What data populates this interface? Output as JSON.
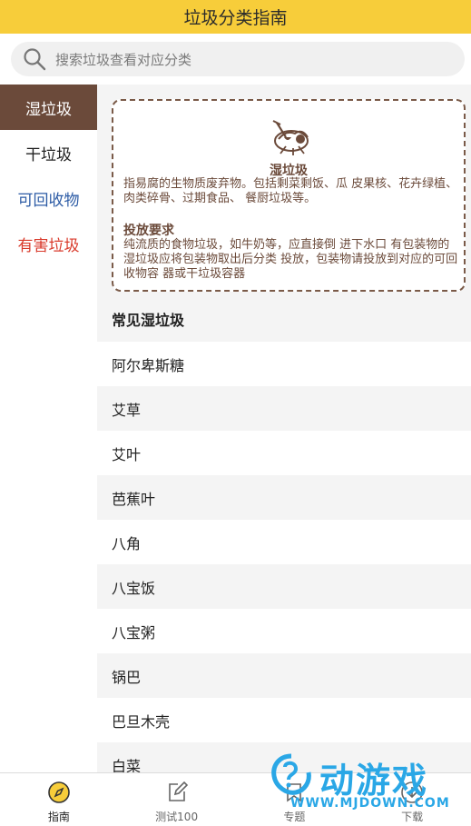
{
  "header": {
    "title": "垃圾分类指南"
  },
  "search": {
    "placeholder": "搜索垃圾查看对应分类",
    "icon": "search-icon"
  },
  "sidebar": {
    "items": [
      {
        "label": "湿垃圾",
        "active": true
      },
      {
        "label": "干垃圾"
      },
      {
        "label": "可回收物"
      },
      {
        "label": "有害垃圾"
      }
    ]
  },
  "card": {
    "title": "湿垃圾",
    "description": "指易腐的生物质废弃物。包括剩菜剩饭、瓜 皮果核、花卉绿植、肉类碎骨、过期食品、 餐厨垃圾等。",
    "requirement_title": "投放要求",
    "requirement_text": "纯流质的食物垃圾，如牛奶等，应直接倒 进下水口 有包装物的湿垃圾应将包装物取出后分类 投放，包装物请投放到对应的可回收物容 器或干垃圾容器"
  },
  "common": {
    "title": "常见湿垃圾",
    "items": [
      "阿尔卑斯糖",
      "艾草",
      "艾叶",
      "芭蕉叶",
      "八角",
      "八宝饭",
      "八宝粥",
      "锅巴",
      "巴旦木壳",
      "白菜"
    ]
  },
  "tabbar": {
    "tabs": [
      {
        "label": "指南",
        "icon": "compass-icon",
        "active": true
      },
      {
        "label": "测试100",
        "icon": "edit-icon"
      },
      {
        "label": "专题",
        "icon": "topic-icon"
      },
      {
        "label": "下载",
        "icon": "download-icon"
      }
    ]
  },
  "watermark": {
    "text": "动游戏",
    "url": "WWW.MJDOWN.COM"
  },
  "colors": {
    "header": "#f7cd3a",
    "active_side": "#6b4a3a",
    "recycle": "#2c5ba5",
    "harmful": "#d93a2b",
    "watermark": "#2aa7e6"
  }
}
